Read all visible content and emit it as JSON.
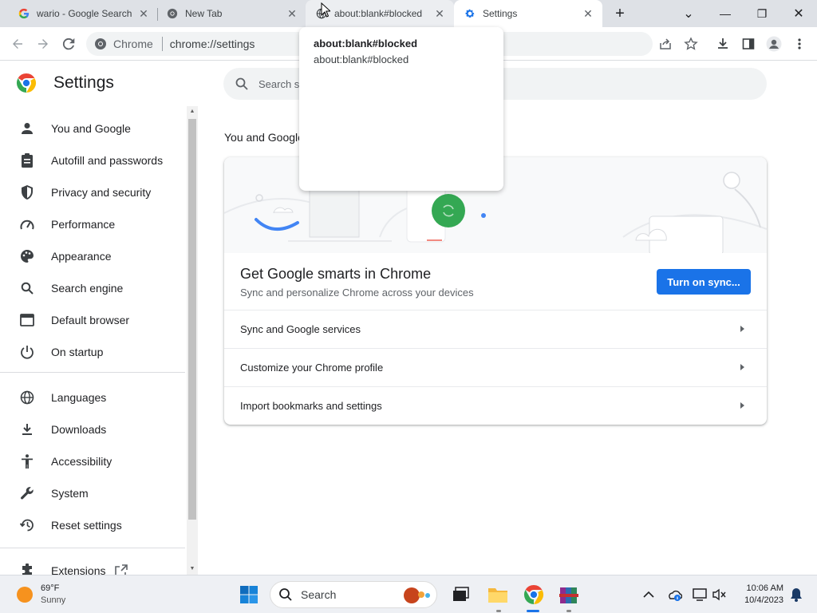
{
  "tabs": [
    {
      "title": "wario - Google Search",
      "favicon": "google-g-icon"
    },
    {
      "title": "New Tab",
      "favicon": "chrome-icon"
    },
    {
      "title": "about:blank#blocked",
      "favicon": "globe-icon"
    },
    {
      "title": "Settings",
      "favicon": "gear-icon"
    }
  ],
  "tab_close_glyph": "✕",
  "new_tab_glyph": "+",
  "window_controls": {
    "tab_search": "⌄",
    "minimize": "—",
    "maximize": "❐",
    "close": "✕"
  },
  "omnibox": {
    "chip_label": "Chrome",
    "url": "chrome://settings"
  },
  "hover_card": {
    "title": "about:blank#blocked",
    "url": "about:blank#blocked"
  },
  "settings": {
    "title": "Settings",
    "search_placeholder": "Search settings",
    "nav_group1": [
      {
        "label": "You and Google",
        "icon": "person-icon"
      },
      {
        "label": "Autofill and passwords",
        "icon": "clipboard-icon"
      },
      {
        "label": "Privacy and security",
        "icon": "shield-icon"
      },
      {
        "label": "Performance",
        "icon": "speedometer-icon"
      },
      {
        "label": "Appearance",
        "icon": "palette-icon"
      },
      {
        "label": "Search engine",
        "icon": "search-icon"
      },
      {
        "label": "Default browser",
        "icon": "browser-icon"
      },
      {
        "label": "On startup",
        "icon": "power-icon"
      }
    ],
    "nav_group2": [
      {
        "label": "Languages",
        "icon": "globe-icon"
      },
      {
        "label": "Downloads",
        "icon": "download-icon"
      },
      {
        "label": "Accessibility",
        "icon": "accessibility-icon"
      },
      {
        "label": "System",
        "icon": "wrench-icon"
      },
      {
        "label": "Reset settings",
        "icon": "reset-icon"
      }
    ],
    "nav_group3": [
      {
        "label": "Extensions",
        "icon": "puzzle-icon"
      }
    ],
    "section_title": "You and Google",
    "card": {
      "heading": "Get Google smarts in Chrome",
      "subtext": "Sync and personalize Chrome across your devices",
      "button": "Turn on sync...",
      "rows": [
        "Sync and Google services",
        "Customize your Chrome profile",
        "Import bookmarks and settings"
      ]
    }
  },
  "taskbar": {
    "weather": {
      "temp": "69°F",
      "condition": "Sunny"
    },
    "search_label": "Search",
    "time": "10:06 AM",
    "date": "10/4/2023"
  },
  "colors": {
    "accent": "#1a73e8",
    "tabstrip": "#dee1e6",
    "sync_green": "#34a853"
  }
}
